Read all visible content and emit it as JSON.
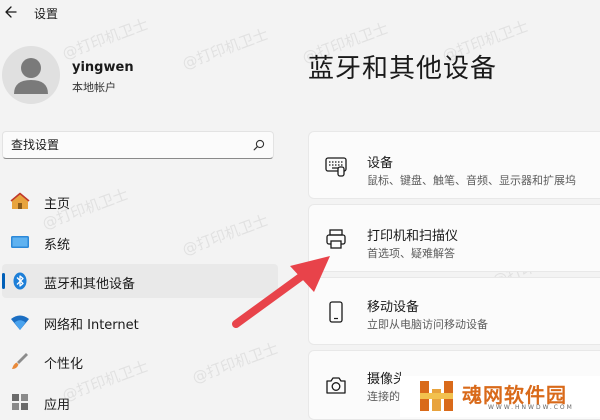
{
  "window": {
    "title": "设置"
  },
  "user": {
    "name": "yingwen",
    "account_type": "本地帐户"
  },
  "search": {
    "placeholder": "查找设置"
  },
  "nav": {
    "items": [
      {
        "label": "主页",
        "icon": "home-icon",
        "active": false
      },
      {
        "label": "系统",
        "icon": "system-icon",
        "active": false
      },
      {
        "label": "蓝牙和其他设备",
        "icon": "bluetooth-icon",
        "active": true
      },
      {
        "label": "网络和 Internet",
        "icon": "network-icon",
        "active": false
      },
      {
        "label": "个性化",
        "icon": "brush-icon",
        "active": false
      },
      {
        "label": "应用",
        "icon": "apps-icon",
        "active": false
      }
    ]
  },
  "page": {
    "title": "蓝牙和其他设备"
  },
  "cards": [
    {
      "title": "设备",
      "desc": "鼠标、键盘、触笔、音频、显示器和扩展坞",
      "icon": "keyboard-icon"
    },
    {
      "title": "打印机和扫描仪",
      "desc": "首选项、疑难解答",
      "icon": "printer-icon"
    },
    {
      "title": "移动设备",
      "desc": "立即从电脑访问移动设备",
      "icon": "phone-icon"
    },
    {
      "title": "摄像头",
      "desc": "连接的摄像头",
      "icon": "camera-icon"
    }
  ],
  "watermark": {
    "text": "@打印机卫士"
  },
  "logo": {
    "name": "魂网软件园",
    "url": "WWW.HNWDW.COM"
  },
  "colors": {
    "accent": "#005fb8",
    "arrow": "#e8434a",
    "logo": "#d96a1a"
  }
}
